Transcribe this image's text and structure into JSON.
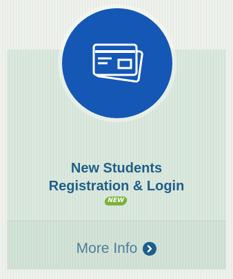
{
  "card": {
    "title_line1": "New Students",
    "title_line2": "Registration & Login",
    "badge": "NEW",
    "more_info_label": "More Info",
    "icon": "credit-card-icon",
    "more_icon": "chevron-right-circle-icon"
  },
  "colors": {
    "circle": "#1457b5",
    "title": "#1f5f88",
    "more_info": "#4d7f9b",
    "badge": "#7bb33a"
  }
}
